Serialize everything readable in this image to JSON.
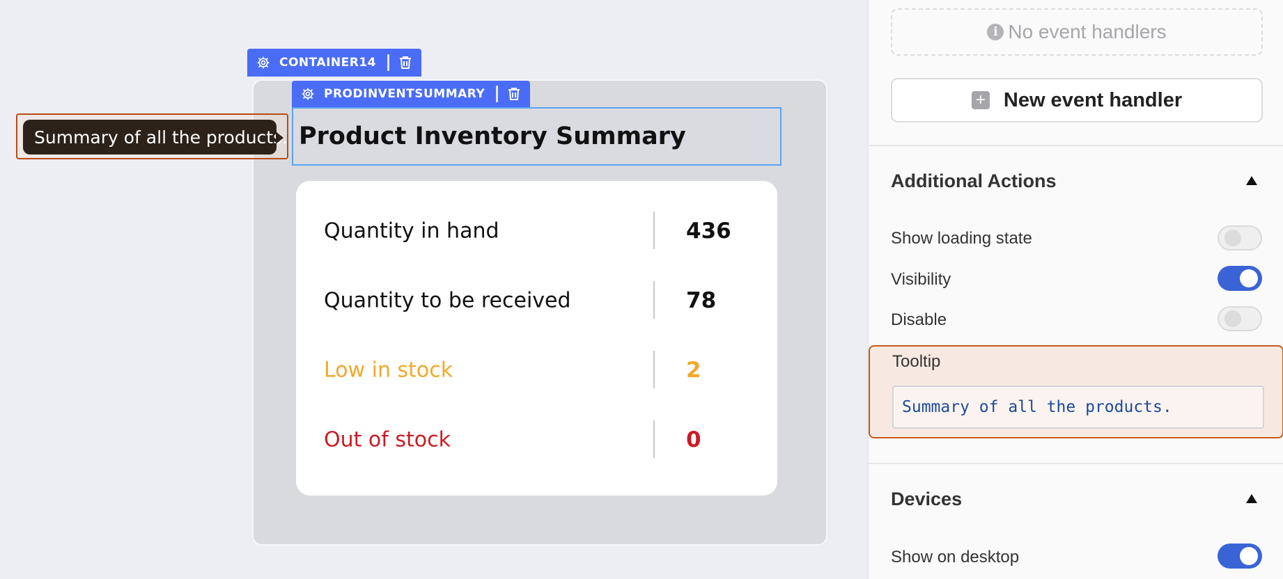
{
  "canvas": {
    "container_tag": "CONTAINER14",
    "component_tag": "PRODINVENTSUMMARY",
    "title": "Product Inventory Summary",
    "tooltip_preview": "Summary of all the products.",
    "rows": [
      {
        "label": "Quantity in hand",
        "value": "436",
        "color": "#111111"
      },
      {
        "label": "Quantity to be received",
        "value": "78",
        "color": "#111111"
      },
      {
        "label": "Low in stock",
        "value": "2",
        "color": "#f0a92a"
      },
      {
        "label": "Out of stock",
        "value": "0",
        "color": "#cc1b24"
      }
    ]
  },
  "panel": {
    "no_event_handlers": "No event handlers",
    "new_event_handler": "New event handler",
    "additional_actions": {
      "title": "Additional Actions",
      "show_loading_state": {
        "label": "Show loading state",
        "on": false
      },
      "visibility": {
        "label": "Visibility",
        "on": true
      },
      "disable": {
        "label": "Disable",
        "on": false
      },
      "tooltip": {
        "label": "Tooltip",
        "value": "Summary of all the products."
      }
    },
    "devices": {
      "title": "Devices",
      "show_on_desktop": {
        "label": "Show on desktop",
        "on": true
      }
    }
  },
  "colors": {
    "accent": "#4a6cf7",
    "toggle_on": "#3a64d6",
    "highlight_border": "#c45b1c",
    "low_stock": "#f0a92a",
    "out_of_stock": "#cc1b24"
  }
}
